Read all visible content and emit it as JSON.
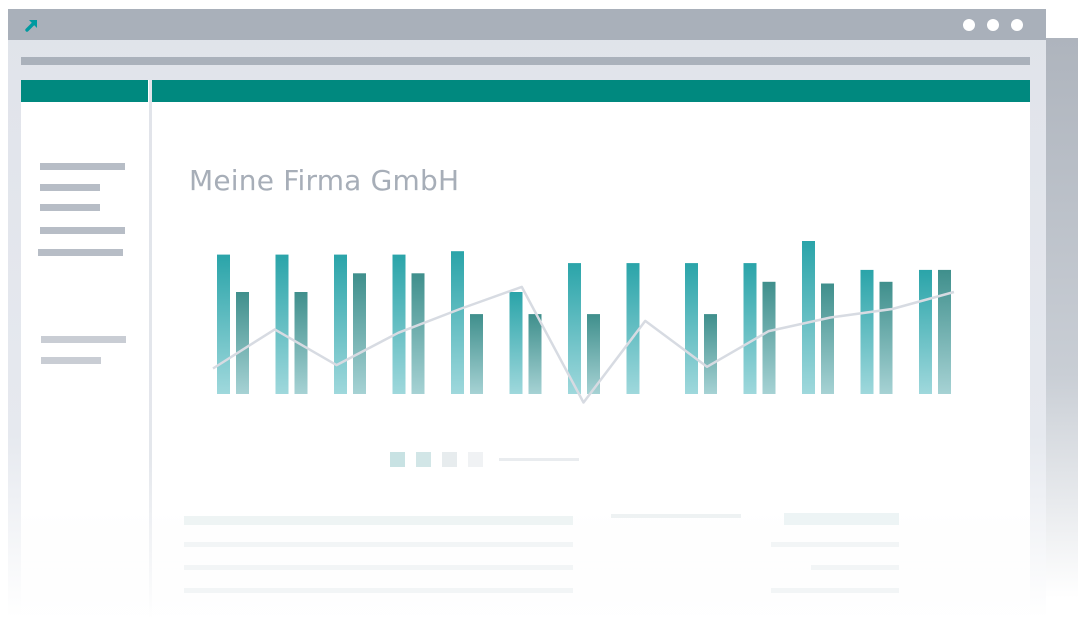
{
  "window": {
    "app_icon": "arrow-up-right-icon",
    "controls": [
      "window-dot-icon",
      "window-dot-icon",
      "window-dot-icon"
    ]
  },
  "colors": {
    "accent": "#00897f",
    "bar_primary_top": "#2aa4a9",
    "bar_primary_bottom": "#9fd8dc",
    "bar_secondary_top": "#3f8f8c",
    "bar_secondary_bottom": "#a6d2d4",
    "line": "#d7dbe2",
    "title": "#a7aeb8"
  },
  "main": {
    "title": "Meine Firma GmbH"
  },
  "chart_data": {
    "type": "bar",
    "categories": [
      "",
      "",
      "",
      "",
      "",
      "",
      "",
      "",
      "",
      "",
      "",
      "",
      ""
    ],
    "series": [
      {
        "type": "bar",
        "values": [
          82,
          82,
          82,
          82,
          84,
          60,
          77,
          77,
          77,
          77,
          90,
          73,
          73
        ]
      },
      {
        "type": "bar",
        "values": [
          60,
          60,
          71,
          71,
          47,
          47,
          47,
          null,
          47,
          66,
          65,
          66,
          73
        ]
      },
      {
        "type": "line",
        "values": [
          15,
          38,
          17,
          36,
          50,
          63,
          -5,
          43,
          16,
          37,
          45,
          50,
          60
        ]
      }
    ],
    "ylim": [
      -20,
      100
    ],
    "grid": false,
    "legend": "bottom"
  }
}
